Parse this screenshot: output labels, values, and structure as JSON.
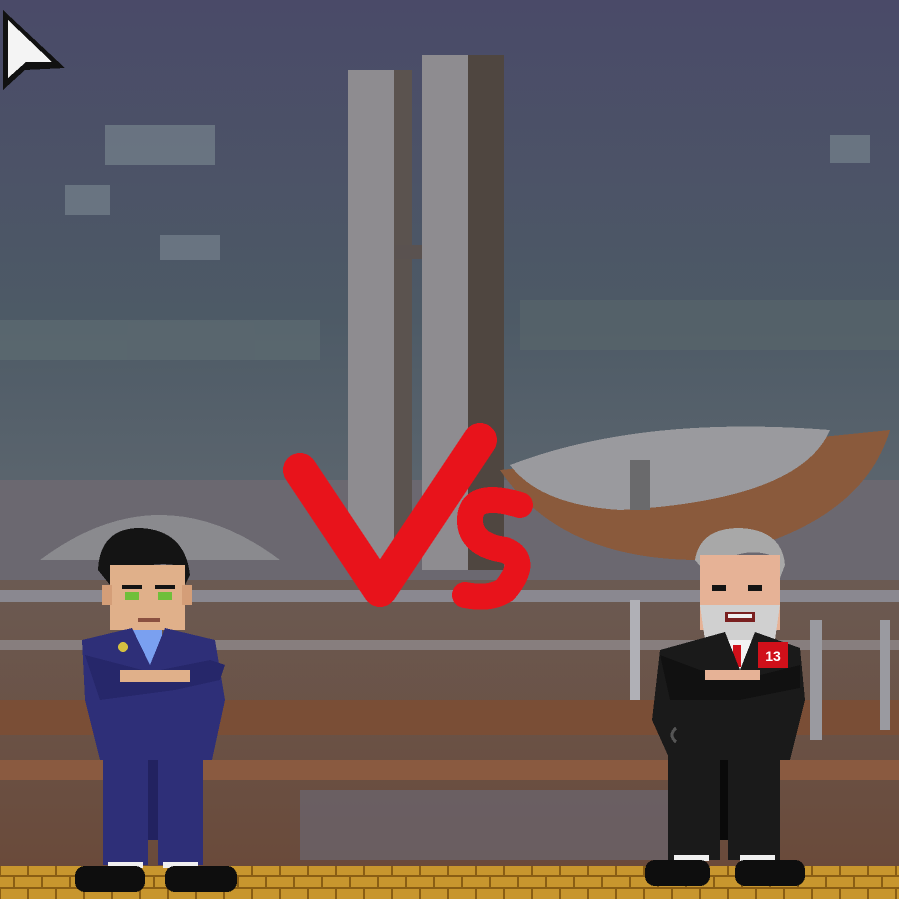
{
  "scene": {
    "name": "versus-screen",
    "vs_text": "Vs",
    "vs_color": "#e8131b",
    "sky_top": "#4a4a6a",
    "sky_mid": "#55606a",
    "brick_color": "#c8962e"
  },
  "fighters": {
    "left": {
      "name": "fighter-left",
      "suit_color": "#2e2f78",
      "stance": "arms-crossed"
    },
    "right": {
      "name": "fighter-right",
      "suit_color": "#1a1a1a",
      "stance": "arms-crossed",
      "badge_text": "13",
      "badge_color": "#d0101a"
    }
  },
  "cursor": {
    "icon": "arrow-cursor-icon"
  }
}
